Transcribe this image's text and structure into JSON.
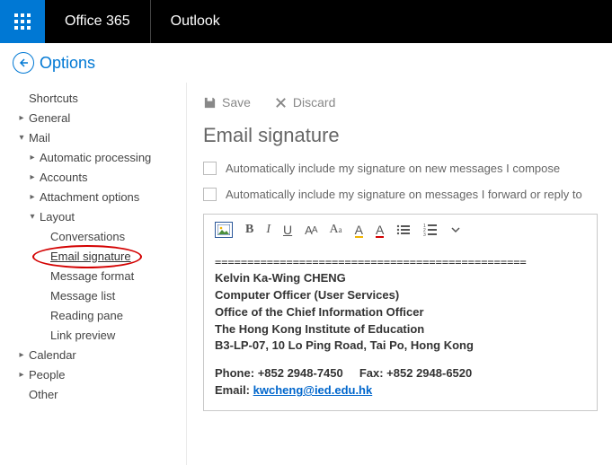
{
  "header": {
    "brand": "Office 365",
    "app": "Outlook"
  },
  "options": {
    "label": "Options"
  },
  "sidebar": {
    "shortcuts": "Shortcuts",
    "general": "General",
    "mail": "Mail",
    "automatic_processing": "Automatic processing",
    "accounts": "Accounts",
    "attachment_options": "Attachment options",
    "layout": "Layout",
    "conversations": "Conversations",
    "email_signature": "Email signature",
    "message_format": "Message format",
    "message_list": "Message list",
    "reading_pane": "Reading pane",
    "link_preview": "Link preview",
    "calendar": "Calendar",
    "people": "People",
    "other": "Other"
  },
  "commands": {
    "save": "Save",
    "discard": "Discard"
  },
  "page": {
    "title": "Email signature"
  },
  "checkboxes": {
    "include_new": "Automatically include my signature on new messages I compose",
    "include_reply": "Automatically include my signature on messages I forward or reply to"
  },
  "signature": {
    "divider": "================================================",
    "name": "Kelvin Ka-Wing CHENG",
    "role": "Computer Officer (User Services)",
    "office": "Office of the Chief Information Officer",
    "org": "The Hong Kong Institute of Education",
    "address": "B3-LP-07, 10 Lo Ping Road, Tai Po, Hong Kong",
    "phone_label": "Phone:",
    "phone": "+852 2948-7450",
    "fax_label": "Fax:",
    "fax": "+852 2948-6520",
    "email_label": "Email:",
    "email": "kwcheng@ied.edu.hk"
  }
}
